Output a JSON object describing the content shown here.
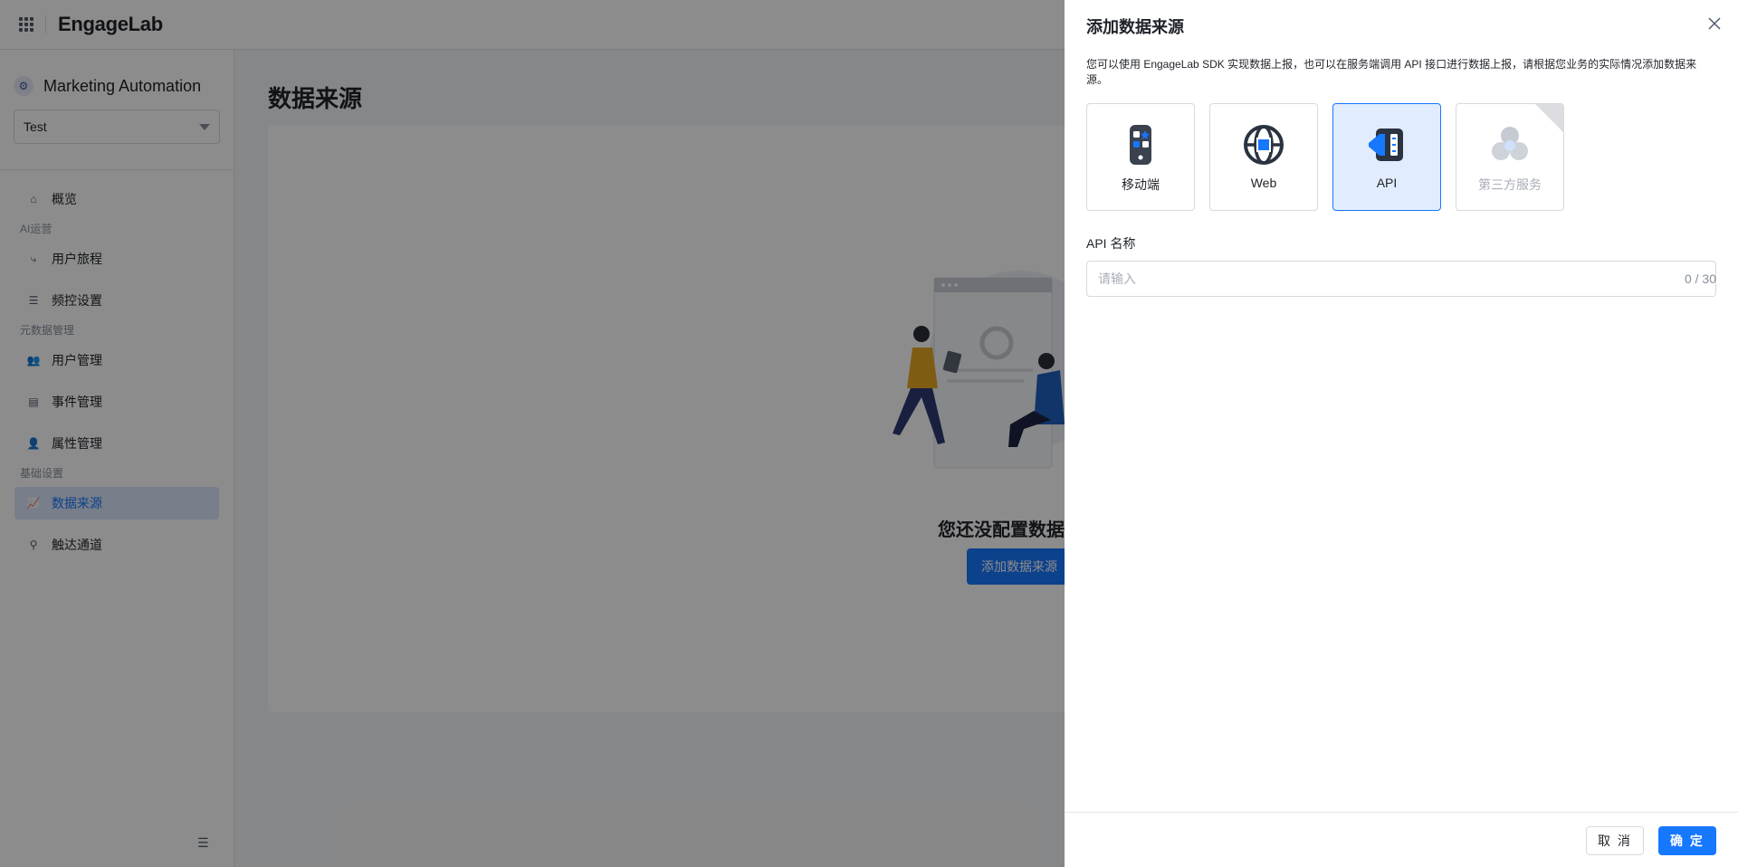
{
  "topbar": {
    "logo": "EngageLab"
  },
  "sidebar": {
    "app_name": "Marketing Automation",
    "project": "Test",
    "items": [
      {
        "label": "概览"
      },
      {
        "group": "AI运营"
      },
      {
        "label": "用户旅程"
      },
      {
        "label": "频控设置"
      },
      {
        "group": "元数据管理"
      },
      {
        "label": "用户管理"
      },
      {
        "label": "事件管理"
      },
      {
        "label": "属性管理"
      },
      {
        "group": "基础设置"
      },
      {
        "label": "数据来源"
      },
      {
        "label": "触达通道"
      }
    ]
  },
  "main": {
    "title": "数据来源",
    "empty_text": "您还没配置数据来源",
    "add_button": "添加数据来源"
  },
  "drawer": {
    "title": "添加数据来源",
    "description": "您可以使用 EngageLab SDK 实现数据上报，也可以在服务端调用 API 接口进行数据上报，请根据您业务的实际情况添加数据来源。",
    "types": [
      {
        "label": "移动端",
        "icon": "mobile-icon"
      },
      {
        "label": "Web",
        "icon": "globe-icon"
      },
      {
        "label": "API",
        "icon": "api-icon",
        "selected": true
      },
      {
        "label": "第三方服务",
        "icon": "third-party-icon",
        "disabled": true
      }
    ],
    "field_label": "API 名称",
    "field_placeholder": "请输入",
    "field_value": "",
    "char_count": "0 / 30",
    "cancel": "取 消",
    "confirm": "确 定"
  },
  "colors": {
    "primary": "#1677ff",
    "selected_bg": "#e1edfe",
    "mask": "rgba(0,0,0,0.45)"
  }
}
